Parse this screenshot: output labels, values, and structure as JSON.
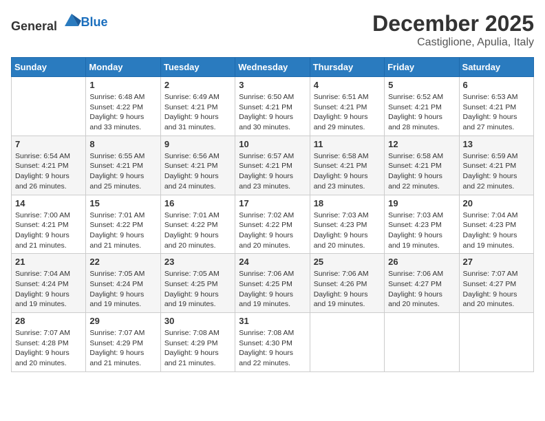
{
  "logo": {
    "general": "General",
    "blue": "Blue"
  },
  "header": {
    "month": "December 2025",
    "location": "Castiglione, Apulia, Italy"
  },
  "weekdays": [
    "Sunday",
    "Monday",
    "Tuesday",
    "Wednesday",
    "Thursday",
    "Friday",
    "Saturday"
  ],
  "weeks": [
    [
      {
        "day": "",
        "sunrise": "",
        "sunset": "",
        "daylight": ""
      },
      {
        "day": "1",
        "sunrise": "Sunrise: 6:48 AM",
        "sunset": "Sunset: 4:22 PM",
        "daylight": "Daylight: 9 hours and 33 minutes."
      },
      {
        "day": "2",
        "sunrise": "Sunrise: 6:49 AM",
        "sunset": "Sunset: 4:21 PM",
        "daylight": "Daylight: 9 hours and 31 minutes."
      },
      {
        "day": "3",
        "sunrise": "Sunrise: 6:50 AM",
        "sunset": "Sunset: 4:21 PM",
        "daylight": "Daylight: 9 hours and 30 minutes."
      },
      {
        "day": "4",
        "sunrise": "Sunrise: 6:51 AM",
        "sunset": "Sunset: 4:21 PM",
        "daylight": "Daylight: 9 hours and 29 minutes."
      },
      {
        "day": "5",
        "sunrise": "Sunrise: 6:52 AM",
        "sunset": "Sunset: 4:21 PM",
        "daylight": "Daylight: 9 hours and 28 minutes."
      },
      {
        "day": "6",
        "sunrise": "Sunrise: 6:53 AM",
        "sunset": "Sunset: 4:21 PM",
        "daylight": "Daylight: 9 hours and 27 minutes."
      }
    ],
    [
      {
        "day": "7",
        "sunrise": "Sunrise: 6:54 AM",
        "sunset": "Sunset: 4:21 PM",
        "daylight": "Daylight: 9 hours and 26 minutes."
      },
      {
        "day": "8",
        "sunrise": "Sunrise: 6:55 AM",
        "sunset": "Sunset: 4:21 PM",
        "daylight": "Daylight: 9 hours and 25 minutes."
      },
      {
        "day": "9",
        "sunrise": "Sunrise: 6:56 AM",
        "sunset": "Sunset: 4:21 PM",
        "daylight": "Daylight: 9 hours and 24 minutes."
      },
      {
        "day": "10",
        "sunrise": "Sunrise: 6:57 AM",
        "sunset": "Sunset: 4:21 PM",
        "daylight": "Daylight: 9 hours and 23 minutes."
      },
      {
        "day": "11",
        "sunrise": "Sunrise: 6:58 AM",
        "sunset": "Sunset: 4:21 PM",
        "daylight": "Daylight: 9 hours and 23 minutes."
      },
      {
        "day": "12",
        "sunrise": "Sunrise: 6:58 AM",
        "sunset": "Sunset: 4:21 PM",
        "daylight": "Daylight: 9 hours and 22 minutes."
      },
      {
        "day": "13",
        "sunrise": "Sunrise: 6:59 AM",
        "sunset": "Sunset: 4:21 PM",
        "daylight": "Daylight: 9 hours and 22 minutes."
      }
    ],
    [
      {
        "day": "14",
        "sunrise": "Sunrise: 7:00 AM",
        "sunset": "Sunset: 4:21 PM",
        "daylight": "Daylight: 9 hours and 21 minutes."
      },
      {
        "day": "15",
        "sunrise": "Sunrise: 7:01 AM",
        "sunset": "Sunset: 4:22 PM",
        "daylight": "Daylight: 9 hours and 21 minutes."
      },
      {
        "day": "16",
        "sunrise": "Sunrise: 7:01 AM",
        "sunset": "Sunset: 4:22 PM",
        "daylight": "Daylight: 9 hours and 20 minutes."
      },
      {
        "day": "17",
        "sunrise": "Sunrise: 7:02 AM",
        "sunset": "Sunset: 4:22 PM",
        "daylight": "Daylight: 9 hours and 20 minutes."
      },
      {
        "day": "18",
        "sunrise": "Sunrise: 7:03 AM",
        "sunset": "Sunset: 4:23 PM",
        "daylight": "Daylight: 9 hours and 20 minutes."
      },
      {
        "day": "19",
        "sunrise": "Sunrise: 7:03 AM",
        "sunset": "Sunset: 4:23 PM",
        "daylight": "Daylight: 9 hours and 19 minutes."
      },
      {
        "day": "20",
        "sunrise": "Sunrise: 7:04 AM",
        "sunset": "Sunset: 4:23 PM",
        "daylight": "Daylight: 9 hours and 19 minutes."
      }
    ],
    [
      {
        "day": "21",
        "sunrise": "Sunrise: 7:04 AM",
        "sunset": "Sunset: 4:24 PM",
        "daylight": "Daylight: 9 hours and 19 minutes."
      },
      {
        "day": "22",
        "sunrise": "Sunrise: 7:05 AM",
        "sunset": "Sunset: 4:24 PM",
        "daylight": "Daylight: 9 hours and 19 minutes."
      },
      {
        "day": "23",
        "sunrise": "Sunrise: 7:05 AM",
        "sunset": "Sunset: 4:25 PM",
        "daylight": "Daylight: 9 hours and 19 minutes."
      },
      {
        "day": "24",
        "sunrise": "Sunrise: 7:06 AM",
        "sunset": "Sunset: 4:25 PM",
        "daylight": "Daylight: 9 hours and 19 minutes."
      },
      {
        "day": "25",
        "sunrise": "Sunrise: 7:06 AM",
        "sunset": "Sunset: 4:26 PM",
        "daylight": "Daylight: 9 hours and 19 minutes."
      },
      {
        "day": "26",
        "sunrise": "Sunrise: 7:06 AM",
        "sunset": "Sunset: 4:27 PM",
        "daylight": "Daylight: 9 hours and 20 minutes."
      },
      {
        "day": "27",
        "sunrise": "Sunrise: 7:07 AM",
        "sunset": "Sunset: 4:27 PM",
        "daylight": "Daylight: 9 hours and 20 minutes."
      }
    ],
    [
      {
        "day": "28",
        "sunrise": "Sunrise: 7:07 AM",
        "sunset": "Sunset: 4:28 PM",
        "daylight": "Daylight: 9 hours and 20 minutes."
      },
      {
        "day": "29",
        "sunrise": "Sunrise: 7:07 AM",
        "sunset": "Sunset: 4:29 PM",
        "daylight": "Daylight: 9 hours and 21 minutes."
      },
      {
        "day": "30",
        "sunrise": "Sunrise: 7:08 AM",
        "sunset": "Sunset: 4:29 PM",
        "daylight": "Daylight: 9 hours and 21 minutes."
      },
      {
        "day": "31",
        "sunrise": "Sunrise: 7:08 AM",
        "sunset": "Sunset: 4:30 PM",
        "daylight": "Daylight: 9 hours and 22 minutes."
      },
      {
        "day": "",
        "sunrise": "",
        "sunset": "",
        "daylight": ""
      },
      {
        "day": "",
        "sunrise": "",
        "sunset": "",
        "daylight": ""
      },
      {
        "day": "",
        "sunrise": "",
        "sunset": "",
        "daylight": ""
      }
    ]
  ]
}
